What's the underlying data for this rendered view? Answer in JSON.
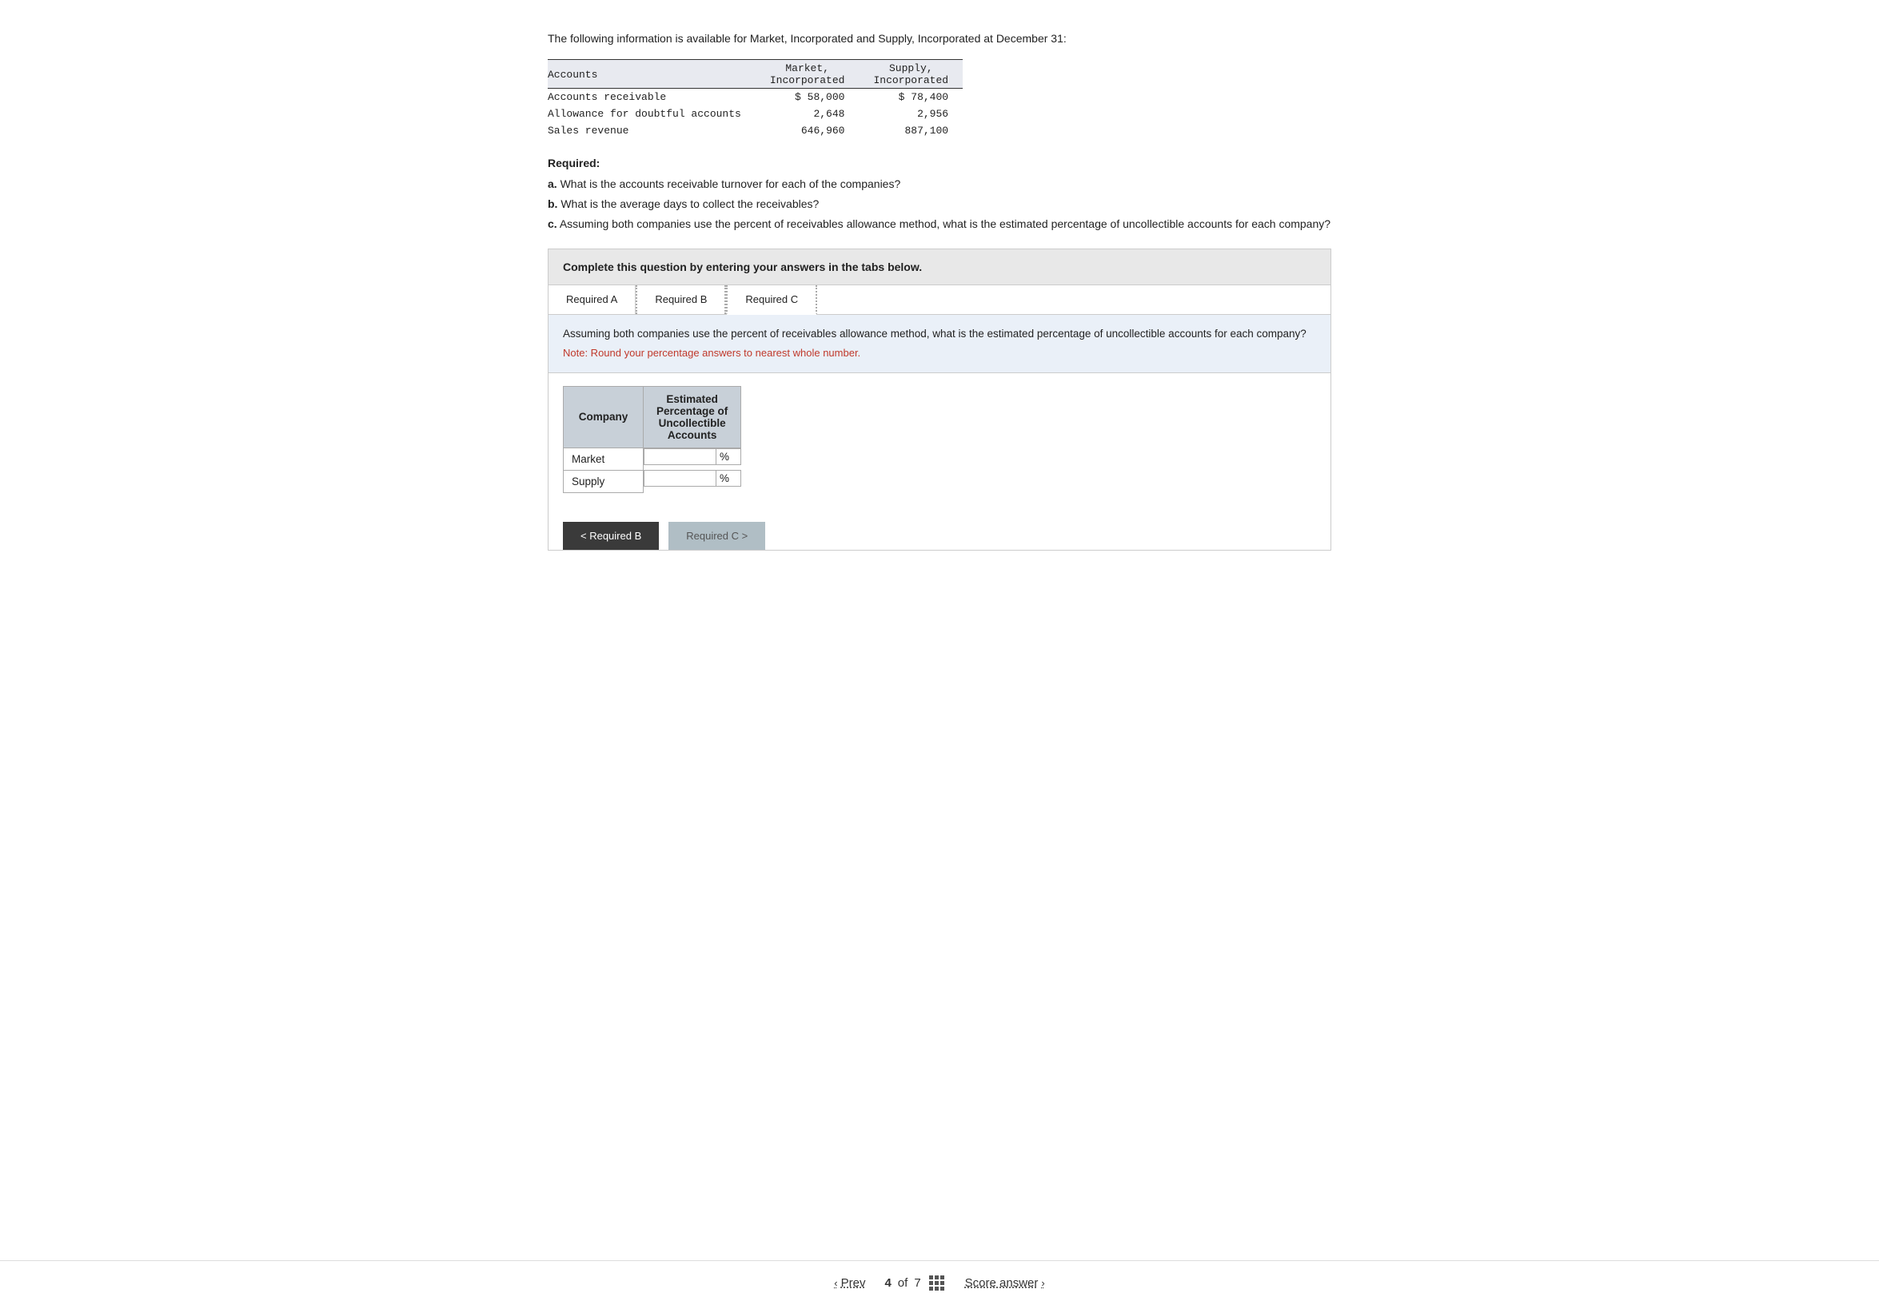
{
  "intro": {
    "text": "The following information is available for Market, Incorporated and Supply, Incorporated at December 31:"
  },
  "table": {
    "headers": [
      "Accounts",
      "Market,\nIncorporated",
      "Supply,\nIncorporated"
    ],
    "rows": [
      [
        "Accounts receivable",
        "$ 58,000",
        "$ 78,400"
      ],
      [
        "Allowance for doubtful accounts",
        "2,648",
        "2,956"
      ],
      [
        "Sales revenue",
        "646,960",
        "887,100"
      ]
    ]
  },
  "required_label": "Required:",
  "required_items": [
    {
      "letter": "a.",
      "text": "What is the accounts receivable turnover for each of the companies?"
    },
    {
      "letter": "b.",
      "text": "What is the average days to collect the receivables?"
    },
    {
      "letter": "c.",
      "text": "Assuming both companies use the percent of receivables allowance method, what is the estimated percentage of uncollectible accounts for each company?"
    }
  ],
  "complete_box": {
    "text": "Complete this question by entering your answers in the tabs below."
  },
  "tabs": [
    {
      "label": "Required A",
      "active": false
    },
    {
      "label": "Required B",
      "active": false
    },
    {
      "label": "Required C",
      "active": true
    }
  ],
  "question_content": {
    "main": "Assuming both companies use the percent of receivables allowance method, what is the estimated percentage of uncollectible accounts for each company?",
    "note": "Note: Round your percentage answers to nearest whole number."
  },
  "answer_table": {
    "col_headers": [
      "Company",
      "Estimated\nPercentage of\nUncollectible\nAccounts"
    ],
    "rows": [
      {
        "company": "Market",
        "value": "",
        "pct": "%"
      },
      {
        "company": "Supply",
        "value": "",
        "pct": "%"
      }
    ]
  },
  "nav_buttons": {
    "prev_label": "< Required B",
    "next_label": "Required C >"
  },
  "bottom_nav": {
    "prev_label": "Prev",
    "page_current": "4",
    "page_of": "of",
    "page_total": "7",
    "score_label": "Score answer",
    "chevron_left": "‹",
    "chevron_right": "›"
  }
}
